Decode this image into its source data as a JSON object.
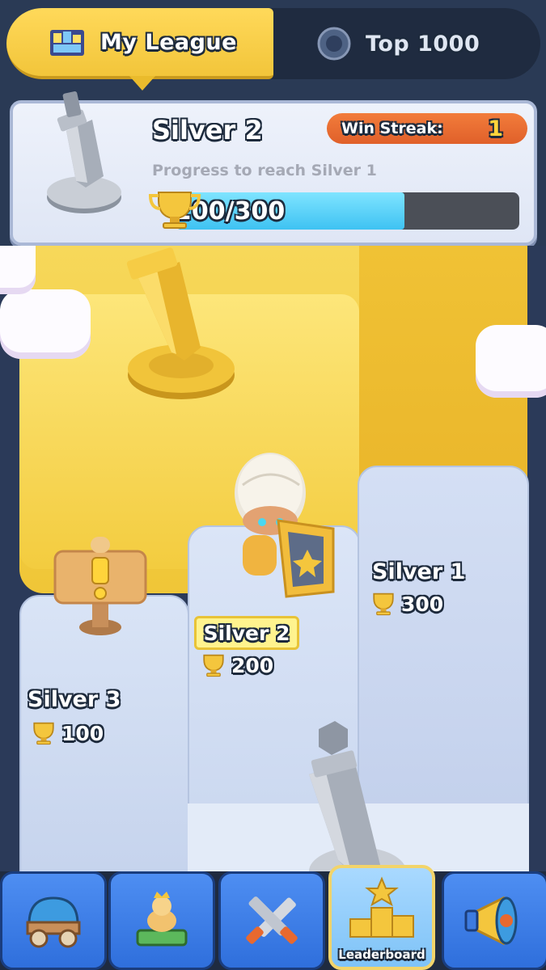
{
  "tabs": [
    {
      "label": "My League",
      "icon": "league-map-icon",
      "selected": true
    },
    {
      "label": "Top 1000",
      "icon": "globe-icon",
      "selected": false
    }
  ],
  "league_card": {
    "rank": "Silver 2",
    "win_streak_label": "Win Streak:",
    "win_streak_value": "1",
    "progress_label": "Progress to reach Silver 1",
    "progress_text": "200/300",
    "progress_fraction": 0.667
  },
  "tiers": [
    {
      "name": "Silver 3",
      "trophies": "100"
    },
    {
      "name": "Silver 2",
      "trophies": "200",
      "current": true
    },
    {
      "name": "Silver 1",
      "trophies": "300"
    }
  ],
  "bottom_nav": {
    "items": [
      {
        "icon": "wagon-icon"
      },
      {
        "icon": "pedestal-icon"
      },
      {
        "icon": "crossed-swords-icon"
      },
      {
        "icon": "leaderboard-podium-icon",
        "label": "Leaderboard",
        "active": true
      },
      {
        "icon": "megaphone-icon"
      }
    ]
  },
  "colors": {
    "gold": "#f4c63d",
    "silver_block": "#c8d6ef",
    "streak": "#e8692f",
    "progress": "#45c6f3",
    "nav_blue": "#3a7ce6"
  }
}
